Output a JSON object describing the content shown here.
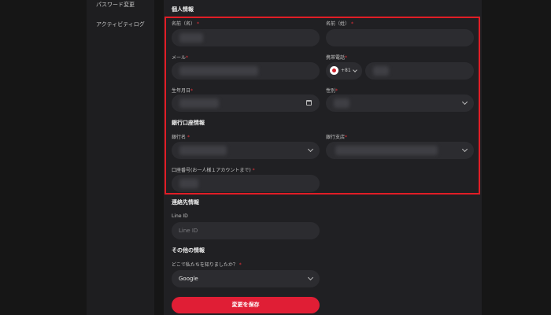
{
  "sidebar": {
    "items": [
      {
        "label": "パスワード変更"
      },
      {
        "label": "アクティビティログ"
      }
    ]
  },
  "personal": {
    "title": "個人情報",
    "first_name_label": "名前（名）",
    "last_name_label": "名前（姓）",
    "email_label": "メール",
    "phone_label": "携帯電話",
    "phone_code": "+81",
    "birthdate_label": "生年月日",
    "gender_label": "性別",
    "required_mark": "*"
  },
  "bank": {
    "title": "銀行口座情報",
    "bank_name_label": "銀行名",
    "branch_label": "銀行支店",
    "account_label": "口座番号(お一人様１アカウントまで)"
  },
  "contact": {
    "title": "連絡先情報",
    "line_label": "Line ID",
    "line_placeholder": "Line ID"
  },
  "other": {
    "title": "その他の情報",
    "source_label": "どこで私たちを知りましたか？",
    "source_value": "Google"
  },
  "actions": {
    "save_label": "変更を保存"
  },
  "colors": {
    "accent": "#e01e35",
    "highlight_border": "#e11d26",
    "background": "#202023",
    "field": "#2c2c30"
  },
  "icons": [
    "calendar-icon",
    "japan-flag-icon",
    "chevron-down-icon"
  ]
}
